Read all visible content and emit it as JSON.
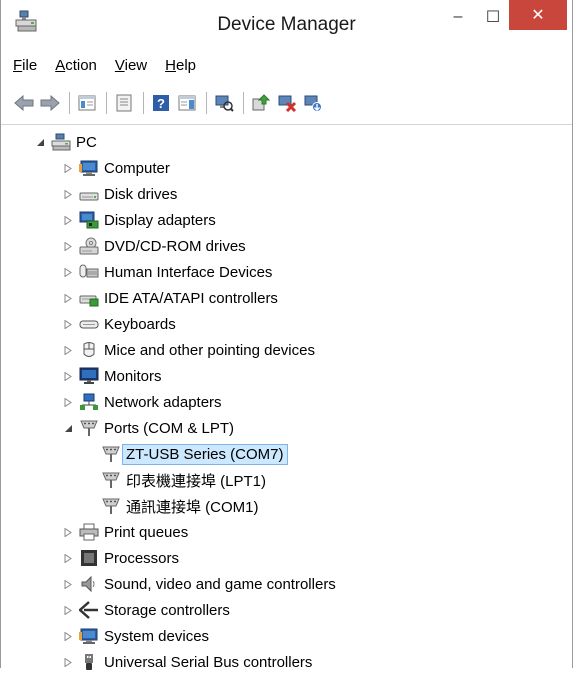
{
  "window": {
    "title": "Device Manager"
  },
  "titlebar": {
    "minimize": "–",
    "maximize": "☐",
    "close": "✕"
  },
  "menu": [
    {
      "mnemonic": "F",
      "rest": "ile"
    },
    {
      "mnemonic": "A",
      "rest": "ction"
    },
    {
      "mnemonic": "V",
      "rest": "iew"
    },
    {
      "mnemonic": "H",
      "rest": "elp"
    }
  ],
  "toolbar_icons": [
    "back-icon",
    "forward-icon",
    "sep",
    "properties-pane-icon",
    "sep",
    "properties-icon",
    "sep",
    "help-icon",
    "action-pane-icon",
    "sep",
    "scan-hardware-icon",
    "sep",
    "update-driver-icon",
    "uninstall-icon",
    "enable-device-icon"
  ],
  "tree": {
    "root": "PC",
    "categories": [
      {
        "label": "Computer",
        "icon": "computer-icon"
      },
      {
        "label": "Disk drives",
        "icon": "disk-drive-icon"
      },
      {
        "label": "Display adapters",
        "icon": "display-adapter-icon"
      },
      {
        "label": "DVD/CD-ROM drives",
        "icon": "dvd-drive-icon"
      },
      {
        "label": "Human Interface Devices",
        "icon": "hid-icon"
      },
      {
        "label": "IDE ATA/ATAPI controllers",
        "icon": "ide-controller-icon"
      },
      {
        "label": "Keyboards",
        "icon": "keyboard-icon"
      },
      {
        "label": "Mice and other pointing devices",
        "icon": "mouse-icon"
      },
      {
        "label": "Monitors",
        "icon": "monitor-icon"
      },
      {
        "label": "Network adapters",
        "icon": "network-adapter-icon"
      },
      {
        "label": "Ports (COM & LPT)",
        "icon": "port-icon",
        "expanded": true,
        "children": [
          {
            "label": "ZT-USB Series (COM7)",
            "selected": true
          },
          {
            "label": "印表機連接埠 (LPT1)"
          },
          {
            "label": "通訊連接埠 (COM1)"
          }
        ]
      },
      {
        "label": "Print queues",
        "icon": "printer-icon"
      },
      {
        "label": "Processors",
        "icon": "processor-icon"
      },
      {
        "label": "Sound, video and game controllers",
        "icon": "speaker-icon"
      },
      {
        "label": "Storage controllers",
        "icon": "storage-controller-icon"
      },
      {
        "label": "System devices",
        "icon": "system-devices-icon"
      },
      {
        "label": "Universal Serial Bus controllers",
        "icon": "usb-icon"
      }
    ]
  }
}
